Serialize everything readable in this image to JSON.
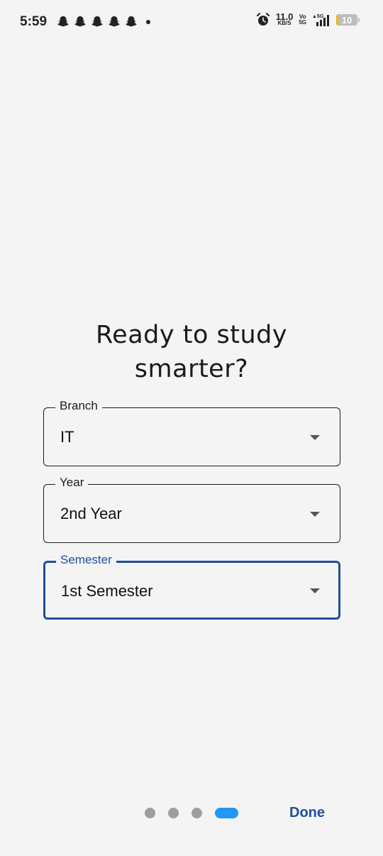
{
  "status_bar": {
    "time": "5:59",
    "notification_icons": [
      "snapchat-icon",
      "snapchat-icon",
      "snapchat-icon",
      "snapchat-icon",
      "snapchat-icon"
    ],
    "net_speed_value": "11.0",
    "net_speed_unit": "KB/S",
    "volte_top": "Vo",
    "volte_bottom": "5G",
    "network_type": "5G",
    "battery_level": "10",
    "battery_fill_percent": 10,
    "battery_color": "#f0b400"
  },
  "onboarding": {
    "title_line1": "Ready to study",
    "title_line2": "smarter?",
    "fields": [
      {
        "label": "Branch",
        "value": "IT",
        "focused": false
      },
      {
        "label": "Year",
        "value": "2nd Year",
        "focused": false
      },
      {
        "label": "Semester",
        "value": "1st Semester",
        "focused": true
      }
    ]
  },
  "pager": {
    "page_count": 4,
    "current_page": 4,
    "active_color": "#2196f3",
    "inactive_color": "#9e9e9e",
    "done_label": "Done",
    "done_color": "#1f4e99"
  },
  "theme": {
    "background": "#f4f4f4",
    "focus_color": "#1f4e99"
  }
}
